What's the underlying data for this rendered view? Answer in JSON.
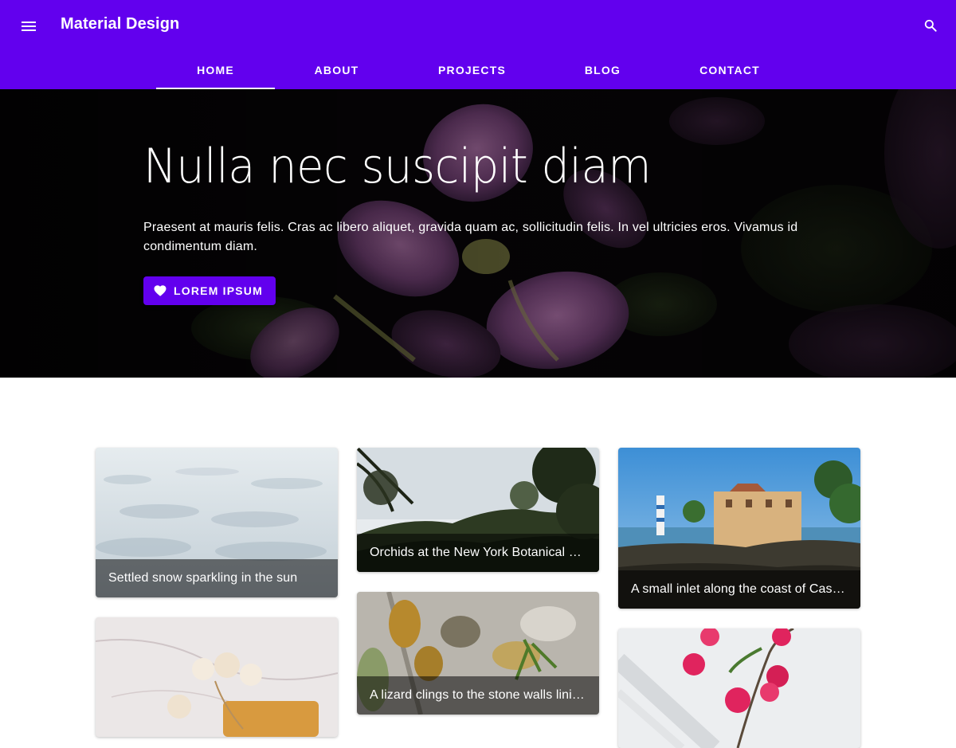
{
  "appbar": {
    "title": "Material Design",
    "menu_icon": "menu-icon",
    "search_icon": "search-icon",
    "color": "#6200ee"
  },
  "tabs": [
    {
      "label": "HOME",
      "active": true
    },
    {
      "label": "ABOUT",
      "active": false
    },
    {
      "label": "PROJECTS",
      "active": false
    },
    {
      "label": "BLOG",
      "active": false
    },
    {
      "label": "CONTACT",
      "active": false
    }
  ],
  "hero": {
    "title": "Nulla nec suscipit diam",
    "text": "Praesent at mauris felis. Cras ac libero aliquet, gravida quam ac, sollicitudin felis. In vel ultricies eros. Vivamus id condimentum diam.",
    "button_label": "LOREM IPSUM",
    "button_icon": "heart-icon"
  },
  "gallery": {
    "cards": [
      {
        "caption": "Settled snow sparkling in the sun",
        "image": "snow-photo"
      },
      {
        "caption": "Orchids at the New York Botanical …",
        "image": "trees-hillside-photo"
      },
      {
        "caption": "A small inlet along the coast of Cas…",
        "image": "coastal-castle-photo"
      },
      {
        "caption": "",
        "image": "dried-flowers-on-marble-photo"
      },
      {
        "caption": "A lizard clings to the stone walls lini…",
        "image": "lichen-stone-wall-photo"
      },
      {
        "caption": "",
        "image": "pink-bougainvillea-photo"
      }
    ]
  }
}
